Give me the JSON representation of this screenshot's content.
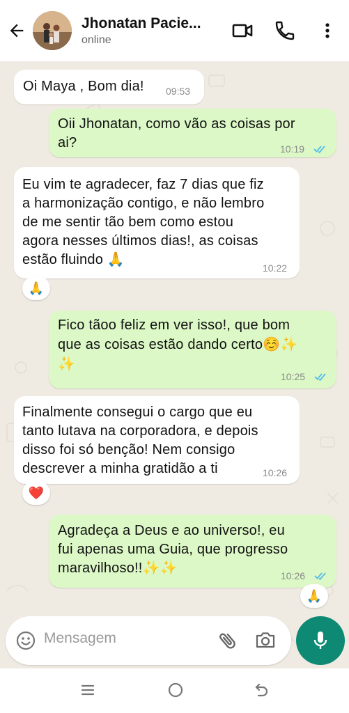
{
  "header": {
    "contact_name": "Jhonatan Pacie...",
    "status": "online",
    "icons": [
      "back-arrow-icon",
      "video-call-icon",
      "phone-icon",
      "more-vert-icon"
    ]
  },
  "messages": [
    {
      "direction": "in",
      "lines": [
        "Oi Maya , Bom dia!"
      ],
      "time": "09:53"
    },
    {
      "direction": "out",
      "lines": [
        "Oii Jhonatan, como vão as coisas por",
        "ai?"
      ],
      "time": "10:19",
      "status": "read"
    },
    {
      "direction": "in",
      "lines": [
        "Eu vim te agradecer, faz 7 dias que fiz",
        "a harmonização contigo, e não lembro",
        "de me sentir tão bem como estou",
        "agora nesses últimos dias!, as coisas",
        "estão fluindo 🙏"
      ],
      "time": "10:22",
      "reaction": "🙏"
    },
    {
      "direction": "out",
      "lines": [
        "Fico tãoo feliz em ver isso!, que bom",
        "que as coisas estão dando certo☺️✨",
        "✨"
      ],
      "time": "10:25",
      "status": "read"
    },
    {
      "direction": "in",
      "lines": [
        "Finalmente consegui o cargo que eu",
        "tanto lutava na corporadora, e depois",
        "disso foi só benção! Nem consigo",
        "descrever a minha gratidão a ti"
      ],
      "time": "10:26",
      "reaction": "❤️"
    },
    {
      "direction": "out",
      "lines": [
        "Agradeça a Deus e ao universo!, eu",
        "fui apenas uma Guia, que progresso",
        "maravilhoso!!✨✨"
      ],
      "time": "10:26",
      "status": "read",
      "reaction": "🙏"
    }
  ],
  "composer": {
    "placeholder": "Mensagem",
    "icons": [
      "emoji-icon",
      "attach-icon",
      "camera-icon",
      "mic-icon"
    ]
  },
  "colors": {
    "outgoing_bubble": "#dcf8c6",
    "incoming_bubble": "#ffffff",
    "chat_background": "#efeae2",
    "read_ticks": "#53bdeb",
    "mic_button": "#0e8a74"
  }
}
